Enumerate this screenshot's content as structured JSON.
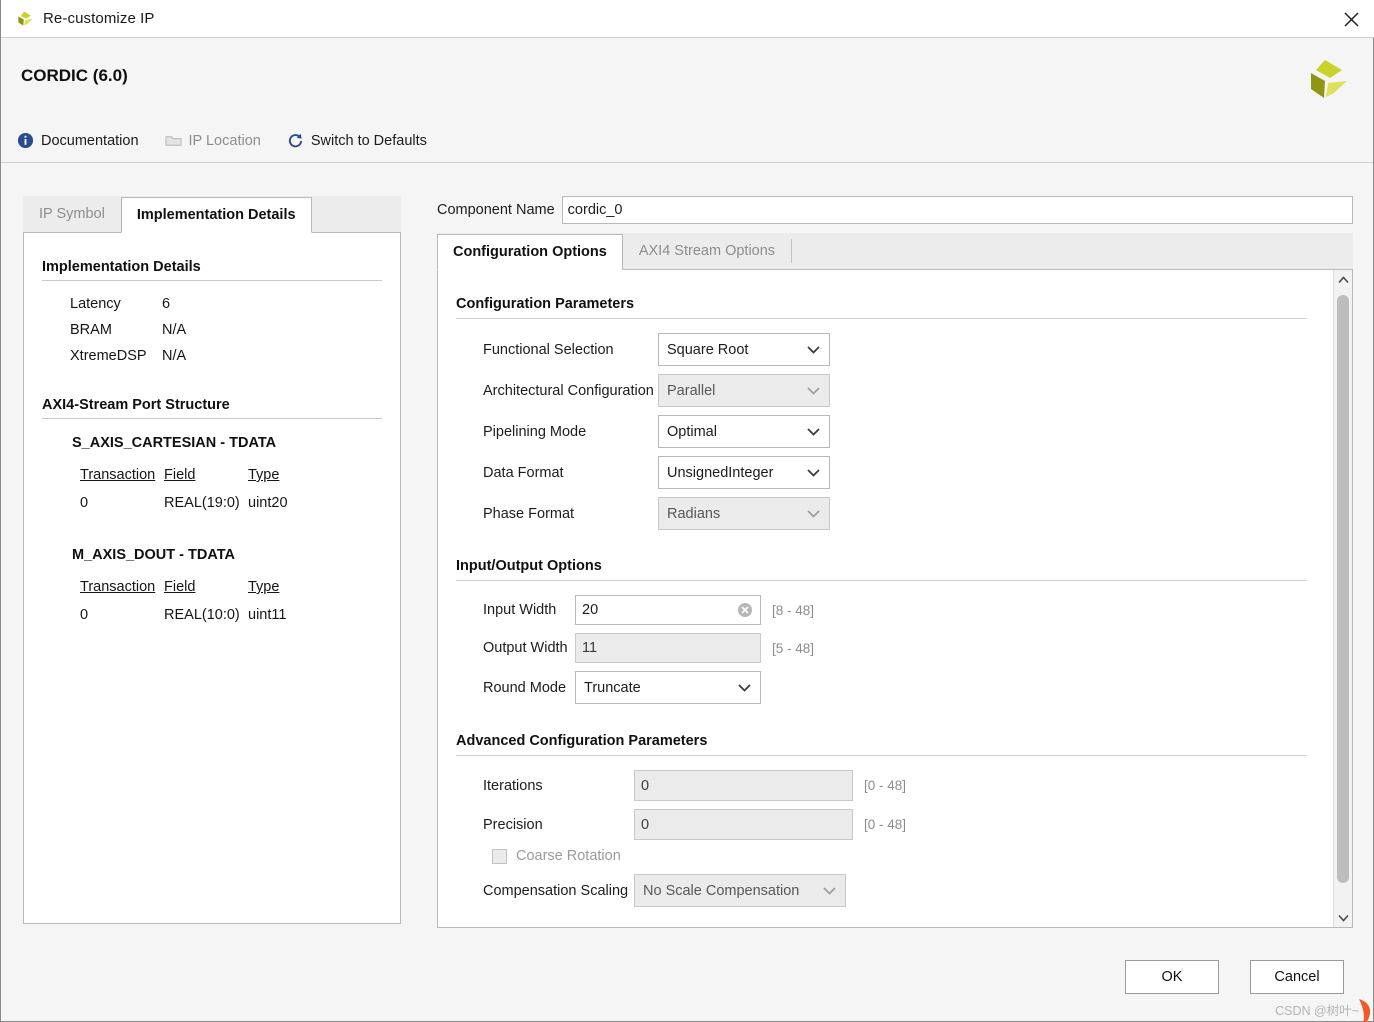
{
  "window": {
    "title": "Re-customize IP",
    "app_icon": "xilinx-logo-icon",
    "close_icon": "close-icon"
  },
  "header": {
    "ip_title": "CORDIC (6.0)",
    "vendor_logo": "xilinx-logo-icon",
    "toolbar": [
      {
        "label": "Documentation",
        "icon": "info-icon",
        "disabled": false
      },
      {
        "label": "IP Location",
        "icon": "folder-icon",
        "disabled": true
      },
      {
        "label": "Switch to Defaults",
        "icon": "refresh-icon",
        "disabled": false
      }
    ]
  },
  "left_panel": {
    "tabs": [
      {
        "label": "IP Symbol",
        "active": false
      },
      {
        "label": "Implementation Details",
        "active": true
      }
    ],
    "impl_details": {
      "heading": "Implementation Details",
      "rows": [
        {
          "key": "Latency",
          "value": "6"
        },
        {
          "key": "BRAM",
          "value": "N/A"
        },
        {
          "key": "XtremeDSP",
          "value": "N/A"
        }
      ]
    },
    "port_structure": {
      "heading": "AXI4-Stream Port Structure",
      "groups": [
        {
          "title": "S_AXIS_CARTESIAN - TDATA",
          "headers": {
            "transaction": "Transaction",
            "field": "Field",
            "type": "Type"
          },
          "rows": [
            {
              "transaction": "0",
              "field": "REAL(19:0)",
              "type": "uint20"
            }
          ]
        },
        {
          "title": "M_AXIS_DOUT - TDATA",
          "headers": {
            "transaction": "Transaction",
            "field": "Field",
            "type": "Type"
          },
          "rows": [
            {
              "transaction": "0",
              "field": "REAL(10:0)",
              "type": "uint11"
            }
          ]
        }
      ]
    }
  },
  "right_panel": {
    "component_name_label": "Component Name",
    "component_name_value": "cordic_0",
    "tabs": [
      {
        "label": "Configuration Options",
        "active": true
      },
      {
        "label": "AXI4 Stream Options",
        "active": false
      }
    ],
    "config_parameters": {
      "heading": "Configuration Parameters",
      "fields": [
        {
          "label": "Functional Selection",
          "value": "Square Root",
          "disabled": false
        },
        {
          "label": "Architectural Configuration",
          "value": "Parallel",
          "disabled": true
        },
        {
          "label": "Pipelining Mode",
          "value": "Optimal",
          "disabled": false
        },
        {
          "label": "Data Format",
          "value": "UnsignedInteger",
          "disabled": false
        },
        {
          "label": "Phase Format",
          "value": "Radians",
          "disabled": true
        }
      ]
    },
    "io_options": {
      "heading": "Input/Output Options",
      "input_width": {
        "label": "Input Width",
        "value": "20",
        "range": "[8 - 48]",
        "disabled": false,
        "clear_icon": "clear-icon"
      },
      "output_width": {
        "label": "Output Width",
        "value": "11",
        "range": "[5 - 48]",
        "disabled": true
      },
      "round_mode": {
        "label": "Round Mode",
        "value": "Truncate",
        "disabled": false
      }
    },
    "advanced": {
      "heading": "Advanced Configuration Parameters",
      "iterations": {
        "label": "Iterations",
        "value": "0",
        "range": "[0 - 48]",
        "disabled": true
      },
      "precision": {
        "label": "Precision",
        "value": "0",
        "range": "[0 - 48]",
        "disabled": true
      },
      "coarse_rotation": {
        "label": "Coarse Rotation",
        "checked": false,
        "disabled": true
      },
      "compensation_scaling": {
        "label": "Compensation Scaling",
        "value": "No Scale Compensation",
        "disabled": true
      }
    },
    "scrollbar": {
      "up_icon": "chevron-up-icon",
      "down_icon": "chevron-down-icon"
    }
  },
  "footer": {
    "ok_label": "OK",
    "cancel_label": "Cancel"
  },
  "watermark": {
    "text": "CSDN @树叶~"
  },
  "colors": {
    "accent_blue": "#2a4b8d",
    "logo_yellow": "#c8d22a",
    "logo_olive": "#8f9613",
    "watermark_orange": "#f05a28",
    "dialog_bg": "#f5f5f5"
  }
}
